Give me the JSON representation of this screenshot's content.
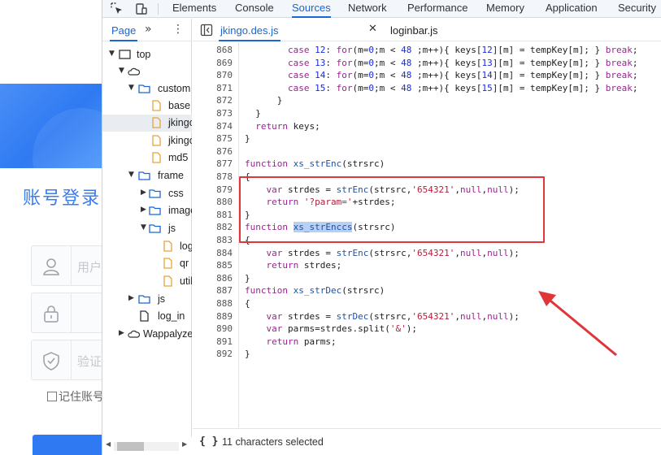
{
  "background_page": {
    "login_title": "账号登录",
    "username_placeholder": "用户",
    "captcha_placeholder": "验证",
    "remember_label": "记住账号",
    "accent_color": "#2f7af2"
  },
  "devtools": {
    "panel_tabs": [
      {
        "label": "Elements",
        "active": false
      },
      {
        "label": "Console",
        "active": false
      },
      {
        "label": "Sources",
        "active": true
      },
      {
        "label": "Network",
        "active": false
      },
      {
        "label": "Performance",
        "active": false
      },
      {
        "label": "Memory",
        "active": false
      },
      {
        "label": "Application",
        "active": false
      },
      {
        "label": "Security",
        "active": false
      }
    ],
    "sidebar": {
      "page_tab": "Page",
      "more_tabs": "»",
      "menu": "⋮",
      "tree": [
        {
          "label": "top",
          "type": "frame",
          "expanded": true
        },
        {
          "label": "",
          "type": "cloud",
          "expanded": true
        },
        {
          "label": "custom",
          "type": "folder",
          "expanded": true
        },
        {
          "label": "base",
          "type": "file"
        },
        {
          "label": "jkingo",
          "type": "file",
          "selected": true
        },
        {
          "label": "jkingo",
          "type": "file"
        },
        {
          "label": "md5",
          "type": "file"
        },
        {
          "label": "frame",
          "type": "folder",
          "expanded": true
        },
        {
          "label": "css",
          "type": "folder",
          "expanded": false
        },
        {
          "label": "images",
          "type": "folder",
          "expanded": false
        },
        {
          "label": "js",
          "type": "folder",
          "expanded": true
        },
        {
          "label": "login",
          "type": "file"
        },
        {
          "label": "qr",
          "type": "file"
        },
        {
          "label": "util",
          "type": "file"
        },
        {
          "label": "js",
          "type": "folder",
          "expanded": false
        },
        {
          "label": "log_in",
          "type": "file"
        },
        {
          "label": "Wappalyzer",
          "type": "cloud",
          "expanded": false
        }
      ]
    },
    "editor_tabs": [
      {
        "label": "jkingo.des.js",
        "active": true,
        "closable": true
      },
      {
        "label": "loginbar.js",
        "active": false,
        "closable": false
      }
    ],
    "code": {
      "lines": [
        {
          "n": "868",
          "text": "        case 12: for(m=0;m < 48 ;m++){ keys[12][m] = tempKey[m]; } break;"
        },
        {
          "n": "869",
          "text": "        case 13: for(m=0;m < 48 ;m++){ keys[13][m] = tempKey[m]; } break;"
        },
        {
          "n": "870",
          "text": "        case 14: for(m=0;m < 48 ;m++){ keys[14][m] = tempKey[m]; } break;"
        },
        {
          "n": "871",
          "text": "        case 15: for(m=0;m < 48 ;m++){ keys[15][m] = tempKey[m]; } break;"
        },
        {
          "n": "872",
          "text": "      }"
        },
        {
          "n": "873",
          "text": "  }"
        },
        {
          "n": "874",
          "text": "  return keys;"
        },
        {
          "n": "875",
          "text": "}"
        },
        {
          "n": "876",
          "text": ""
        },
        {
          "n": "877",
          "text": "function xs_strEnc(strsrc)"
        },
        {
          "n": "878",
          "text": "{"
        },
        {
          "n": "879",
          "text": "    var strdes = strEnc(strsrc,'654321',null,null);"
        },
        {
          "n": "880",
          "text": "    return '?param='+strdes;"
        },
        {
          "n": "881",
          "text": "}"
        },
        {
          "n": "882",
          "text": "function xs_strEnccs(strsrc)"
        },
        {
          "n": "883",
          "text": "{"
        },
        {
          "n": "884",
          "text": "    var strdes = strEnc(strsrc,'654321',null,null);"
        },
        {
          "n": "885",
          "text": "    return strdes;"
        },
        {
          "n": "886",
          "text": "}"
        },
        {
          "n": "887",
          "text": "function xs_strDec(strsrc)"
        },
        {
          "n": "888",
          "text": "{"
        },
        {
          "n": "889",
          "text": "    var strdes = strDec(strsrc,'654321',null,null);"
        },
        {
          "n": "890",
          "text": "    var parms=strdes.split('&');"
        },
        {
          "n": "891",
          "text": "    return parms;"
        },
        {
          "n": "892",
          "text": "}"
        }
      ],
      "selected_text": "xs_strEnccs"
    },
    "status": {
      "braces": "{ }",
      "text": "11 characters selected"
    },
    "colors": {
      "active_tab": "#1a66d2",
      "keyword": "#9b2393",
      "string": "#b0213d",
      "number": "#1a2cd4",
      "annotation_red": "#e0363a"
    }
  }
}
